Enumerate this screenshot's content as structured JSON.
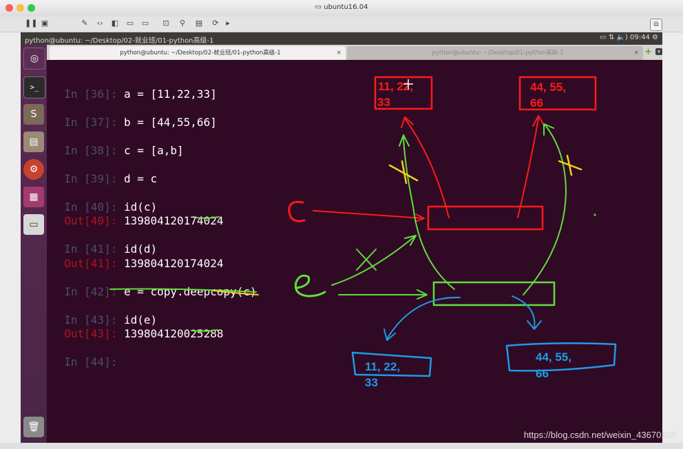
{
  "vm": {
    "window_title": "ubuntu16.04",
    "toolbar_icons": [
      "pause-icon",
      "vm-icon",
      "tools-icon",
      "network-icon",
      "snapshot-icon",
      "display-icon",
      "settings-icon",
      "usb-icon",
      "save-icon",
      "print-icon",
      "more-icon"
    ]
  },
  "panel": {
    "title": "python@ubuntu: ~/Desktop/02-就业班/01-python高级-1",
    "status": "⇅  🔈)  09:44  ⚙"
  },
  "launcher": {
    "items": [
      "dash-icon",
      "terminal-icon",
      "sublime-icon",
      "files-icon",
      "settings-icon",
      "workspace-icon",
      "drive-icon",
      "trash-icon"
    ]
  },
  "terminal": {
    "tabs": [
      {
        "label": "python@ubuntu: ~/Desktop/02-就业班/01-python高级-1",
        "close": "×"
      },
      {
        "label": "python@ubuntu: ~/Desktop/01-python基础-1",
        "close": "×"
      }
    ],
    "add_tab": "+",
    "lines": [
      {
        "type": "in",
        "num": "36",
        "text": "a = [11,22,33]"
      },
      {
        "type": "in",
        "num": "37",
        "text": "b = [44,55,66]"
      },
      {
        "type": "in",
        "num": "38",
        "text": "c = [a,b]"
      },
      {
        "type": "in",
        "num": "39",
        "text": "d = c"
      },
      {
        "type": "in",
        "num": "40",
        "text": "id(c)"
      },
      {
        "type": "out",
        "num": "40",
        "text": "139804120174024"
      },
      {
        "type": "in",
        "num": "41",
        "text": "id(d)"
      },
      {
        "type": "out",
        "num": "41",
        "text": "139804120174024"
      },
      {
        "type": "in",
        "num": "42",
        "text": "e = copy.deepcopy(c)"
      },
      {
        "type": "in",
        "num": "43",
        "text": "id(e)"
      },
      {
        "type": "out",
        "num": "43",
        "text": "139804120025288"
      },
      {
        "type": "in",
        "num": "44",
        "text": ""
      }
    ]
  },
  "annotations": {
    "red_list_a": "11, 22,\n33",
    "red_list_b": "44, 55,\n66",
    "blue_list_a": "11, 22,\n33",
    "blue_list_b": "44, 55,\n66",
    "label_c": "C",
    "label_e": "e",
    "colors": {
      "red": "#ff1a1a",
      "green": "#5ee03a",
      "blue": "#1e9be8",
      "yellow": "#f2d31a"
    }
  },
  "watermark": "https://blog.csdn.net/weixin_43670105"
}
